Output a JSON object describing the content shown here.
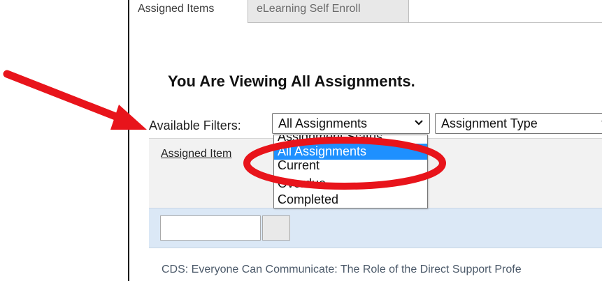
{
  "tabs": {
    "assigned": "Assigned Items",
    "elearning": "eLearning Self Enroll"
  },
  "heading": "You Are Viewing All Assignments.",
  "filters": {
    "label": "Available Filters:",
    "assignments_select": "All Assignments",
    "type_select": "Assignment Type"
  },
  "table": {
    "column_link": "Assigned Item",
    "row_text": "CDS: Everyone Can Communicate: The Role of the Direct Support Profe"
  },
  "dropdown": {
    "options": [
      {
        "label": "Assignment Status",
        "selected": false
      },
      {
        "label": "All Assignments",
        "selected": true
      },
      {
        "label": "Current",
        "selected": false
      },
      {
        "label": "Overdue",
        "selected": false
      },
      {
        "label": "Completed",
        "selected": false
      }
    ]
  },
  "colors": {
    "annotation": "#e8141b",
    "selected_option": "#1e90ff",
    "filter_bar": "#dbe8f6"
  },
  "icons": {
    "select_chevron": "chevron-down-icon",
    "filter_button": "filter-icon"
  }
}
